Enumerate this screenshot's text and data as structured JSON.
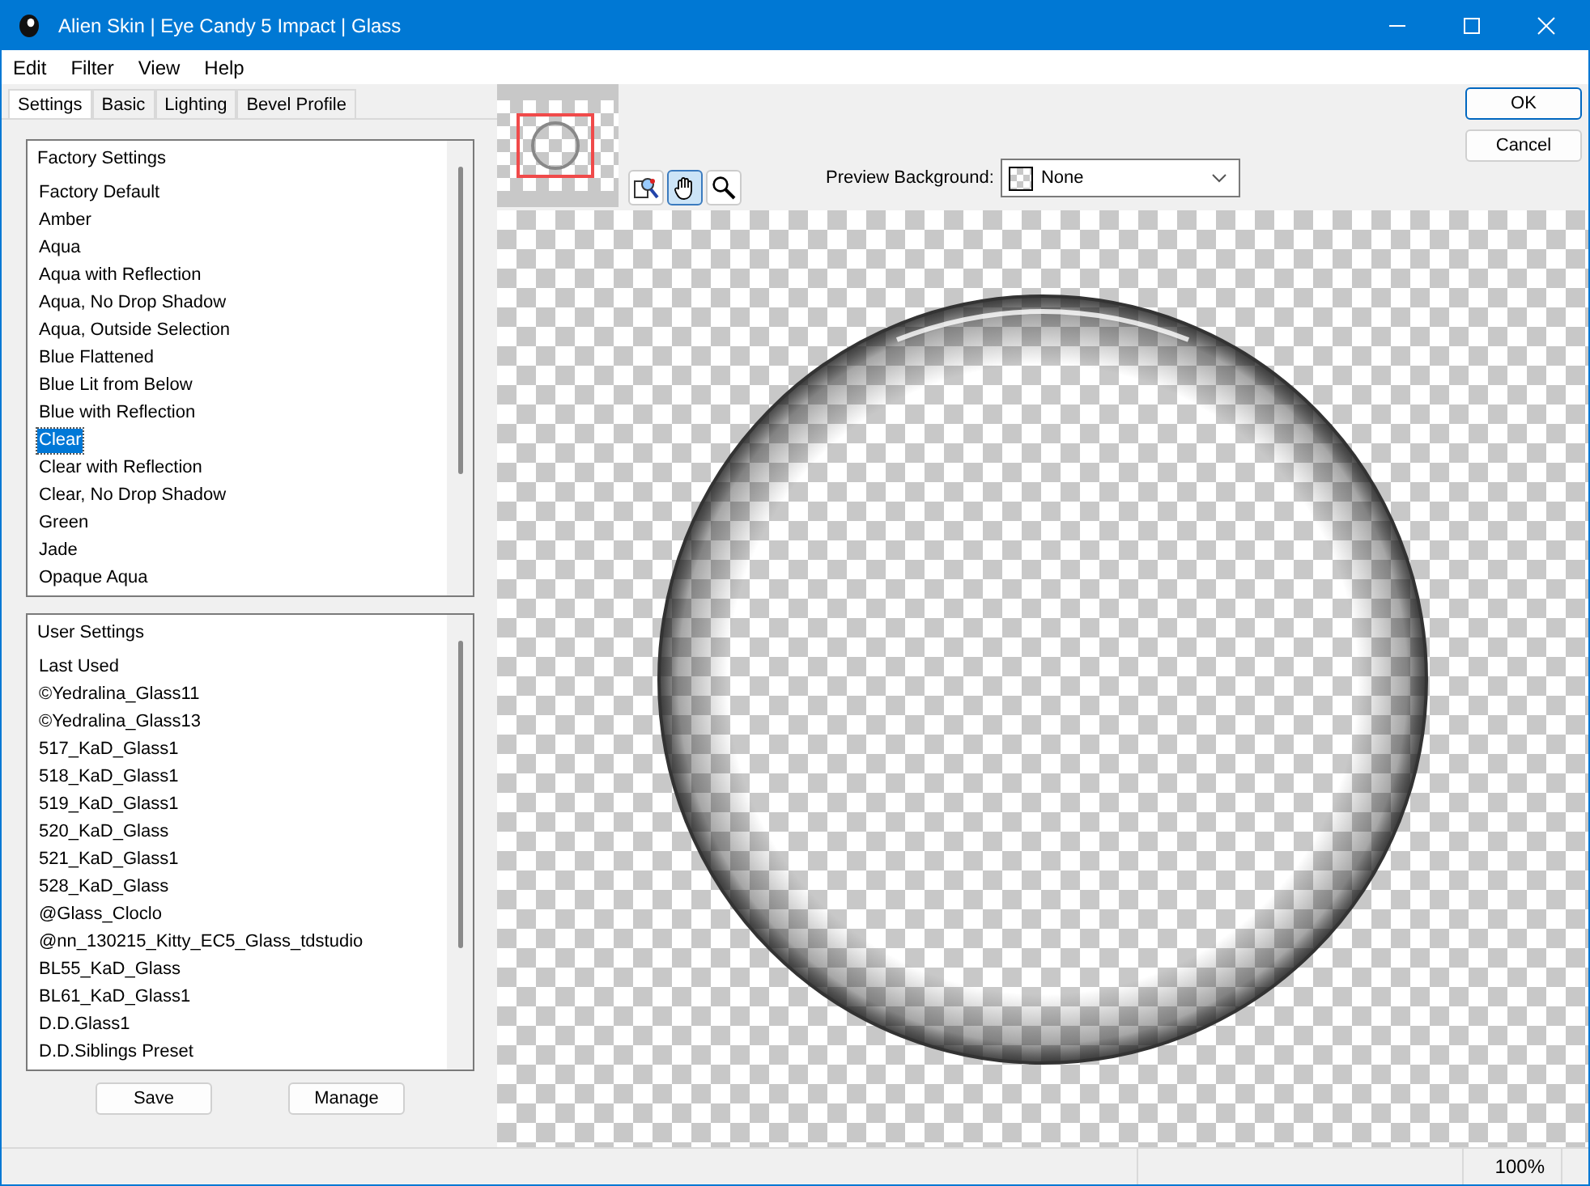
{
  "window": {
    "title": "Alien Skin | Eye Candy 5 Impact | Glass"
  },
  "menu": [
    {
      "label": "Edit"
    },
    {
      "label": "Filter"
    },
    {
      "label": "View"
    },
    {
      "label": "Help"
    }
  ],
  "tabs": [
    {
      "label": "Settings",
      "selected": true
    },
    {
      "label": "Basic",
      "selected": false
    },
    {
      "label": "Lighting",
      "selected": false
    },
    {
      "label": "Bevel Profile",
      "selected": false
    }
  ],
  "factory_settings": {
    "heading": "Factory Settings",
    "items": [
      {
        "label": "Factory Default",
        "selected": false
      },
      {
        "label": "Amber",
        "selected": false
      },
      {
        "label": "Aqua",
        "selected": false
      },
      {
        "label": "Aqua with Reflection",
        "selected": false
      },
      {
        "label": "Aqua, No Drop Shadow",
        "selected": false
      },
      {
        "label": "Aqua, Outside Selection",
        "selected": false
      },
      {
        "label": "Blue Flattened",
        "selected": false
      },
      {
        "label": "Blue Lit from Below",
        "selected": false
      },
      {
        "label": "Blue with Reflection",
        "selected": false
      },
      {
        "label": "Clear",
        "selected": true
      },
      {
        "label": "Clear with Reflection",
        "selected": false
      },
      {
        "label": "Clear, No Drop Shadow",
        "selected": false
      },
      {
        "label": "Green",
        "selected": false
      },
      {
        "label": "Jade",
        "selected": false
      },
      {
        "label": "Opaque Aqua",
        "selected": false
      }
    ]
  },
  "user_settings": {
    "heading": "User Settings",
    "items": [
      {
        "label": "Last Used",
        "selected": false
      },
      {
        "label": "©Yedralina_Glass11",
        "selected": false
      },
      {
        "label": "©Yedralina_Glass13",
        "selected": false
      },
      {
        "label": "517_KaD_Glass1",
        "selected": false
      },
      {
        "label": "518_KaD_Glass1",
        "selected": false
      },
      {
        "label": "519_KaD_Glass1",
        "selected": false
      },
      {
        "label": "520_KaD_Glass",
        "selected": false
      },
      {
        "label": "521_KaD_Glass1",
        "selected": false
      },
      {
        "label": "528_KaD_Glass",
        "selected": false
      },
      {
        "label": "@Glass_Cloclo",
        "selected": false
      },
      {
        "label": "@nn_130215_Kitty_EC5_Glass_tdstudio",
        "selected": false
      },
      {
        "label": "BL55_KaD_Glass",
        "selected": false
      },
      {
        "label": "BL61_KaD_Glass1",
        "selected": false
      },
      {
        "label": "D.D.Glass1",
        "selected": false
      },
      {
        "label": "D.D.Siblings Preset",
        "selected": false
      }
    ]
  },
  "settings_buttons": [
    "Save",
    "Manage"
  ],
  "tools": [
    {
      "kind": "picker",
      "selected": false
    },
    {
      "kind": "hand",
      "selected": true
    },
    {
      "kind": "zoom",
      "selected": false
    }
  ],
  "preview_background": {
    "label": "Preview Background:",
    "value": "None"
  },
  "dialog_buttons": [
    "OK",
    "Cancel"
  ],
  "status_bar": {
    "zoom": "100%"
  }
}
